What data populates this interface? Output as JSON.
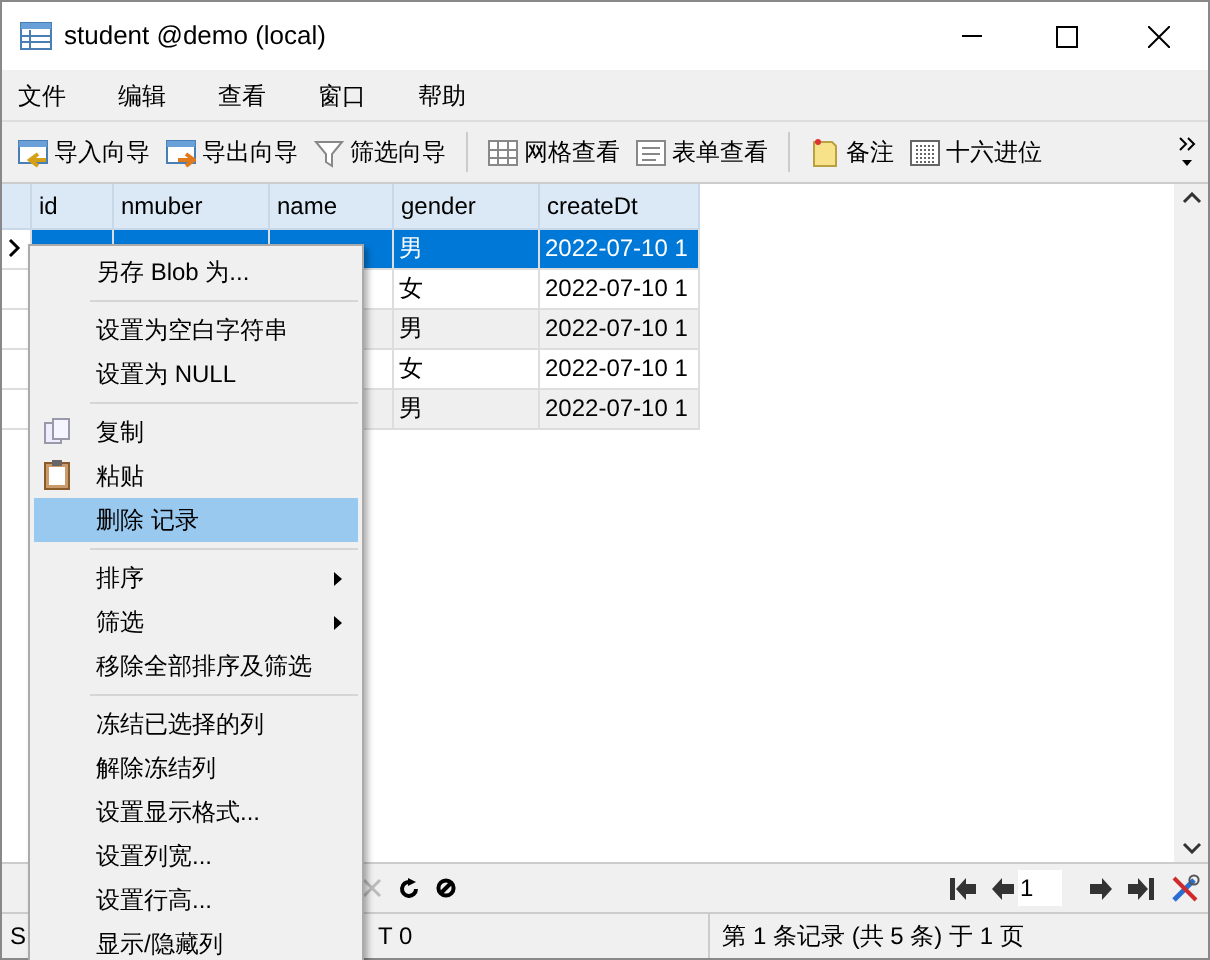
{
  "window": {
    "title": "student @demo (local)"
  },
  "menu_bar": [
    "文件",
    "编辑",
    "查看",
    "窗口",
    "帮助"
  ],
  "toolbar": [
    {
      "label": "导入向导",
      "kind": "import"
    },
    {
      "label": "导出向导",
      "kind": "export"
    },
    {
      "label": "筛选向导",
      "kind": "filter"
    },
    {
      "label": "网格查看",
      "kind": "grid"
    },
    {
      "label": "表单查看",
      "kind": "form"
    },
    {
      "label": "备注",
      "kind": "note"
    },
    {
      "label": "十六进位",
      "kind": "hex"
    }
  ],
  "table": {
    "columns": [
      "id",
      "nmuber",
      "name",
      "gender",
      "createDt"
    ],
    "rows": [
      {
        "selected": true,
        "current": true,
        "gender": "男",
        "createDt": "2022-07-10 1"
      },
      {
        "selected": false,
        "current": false,
        "gender": "女",
        "createDt": "2022-07-10 1"
      },
      {
        "selected": false,
        "current": false,
        "gender": "男",
        "createDt": "2022-07-10 1"
      },
      {
        "selected": false,
        "current": false,
        "gender": "女",
        "createDt": "2022-07-10 1"
      },
      {
        "selected": false,
        "current": false,
        "gender": "男",
        "createDt": "2022-07-10 1"
      }
    ]
  },
  "context_menu": [
    {
      "kind": "item",
      "label": "另存 Blob 为...",
      "selected": false,
      "submenu": false
    },
    {
      "kind": "separator"
    },
    {
      "kind": "item",
      "label": "设置为空白字符串",
      "selected": false,
      "submenu": false
    },
    {
      "kind": "item",
      "label": "设置为 NULL",
      "selected": false,
      "submenu": false
    },
    {
      "kind": "separator"
    },
    {
      "kind": "copy",
      "label": "复制",
      "selected": false,
      "submenu": false
    },
    {
      "kind": "paste",
      "label": "粘贴",
      "selected": false,
      "submenu": false
    },
    {
      "kind": "item",
      "label": "删除 记录",
      "selected": true,
      "submenu": false
    },
    {
      "kind": "separator"
    },
    {
      "kind": "item",
      "label": "排序",
      "selected": false,
      "submenu": true
    },
    {
      "kind": "item",
      "label": "筛选",
      "selected": false,
      "submenu": true
    },
    {
      "kind": "item",
      "label": "移除全部排序及筛选",
      "selected": false,
      "submenu": false
    },
    {
      "kind": "separator"
    },
    {
      "kind": "item",
      "label": "冻结已选择的列",
      "selected": false,
      "submenu": false
    },
    {
      "kind": "item",
      "label": "解除冻结列",
      "selected": false,
      "submenu": false
    },
    {
      "kind": "item",
      "label": "设置显示格式...",
      "selected": false,
      "submenu": false
    },
    {
      "kind": "item",
      "label": "设置列宽...",
      "selected": false,
      "submenu": false
    },
    {
      "kind": "item",
      "label": "设置行高...",
      "selected": false,
      "submenu": false
    },
    {
      "kind": "item",
      "label": "显示/隐藏列",
      "selected": false,
      "submenu": false
    }
  ],
  "navigator": {
    "page": "1"
  },
  "status_bar": {
    "left": "S",
    "middle": "T 0",
    "right": "第 1 条记录 (共 5 条) 于 1 页"
  }
}
